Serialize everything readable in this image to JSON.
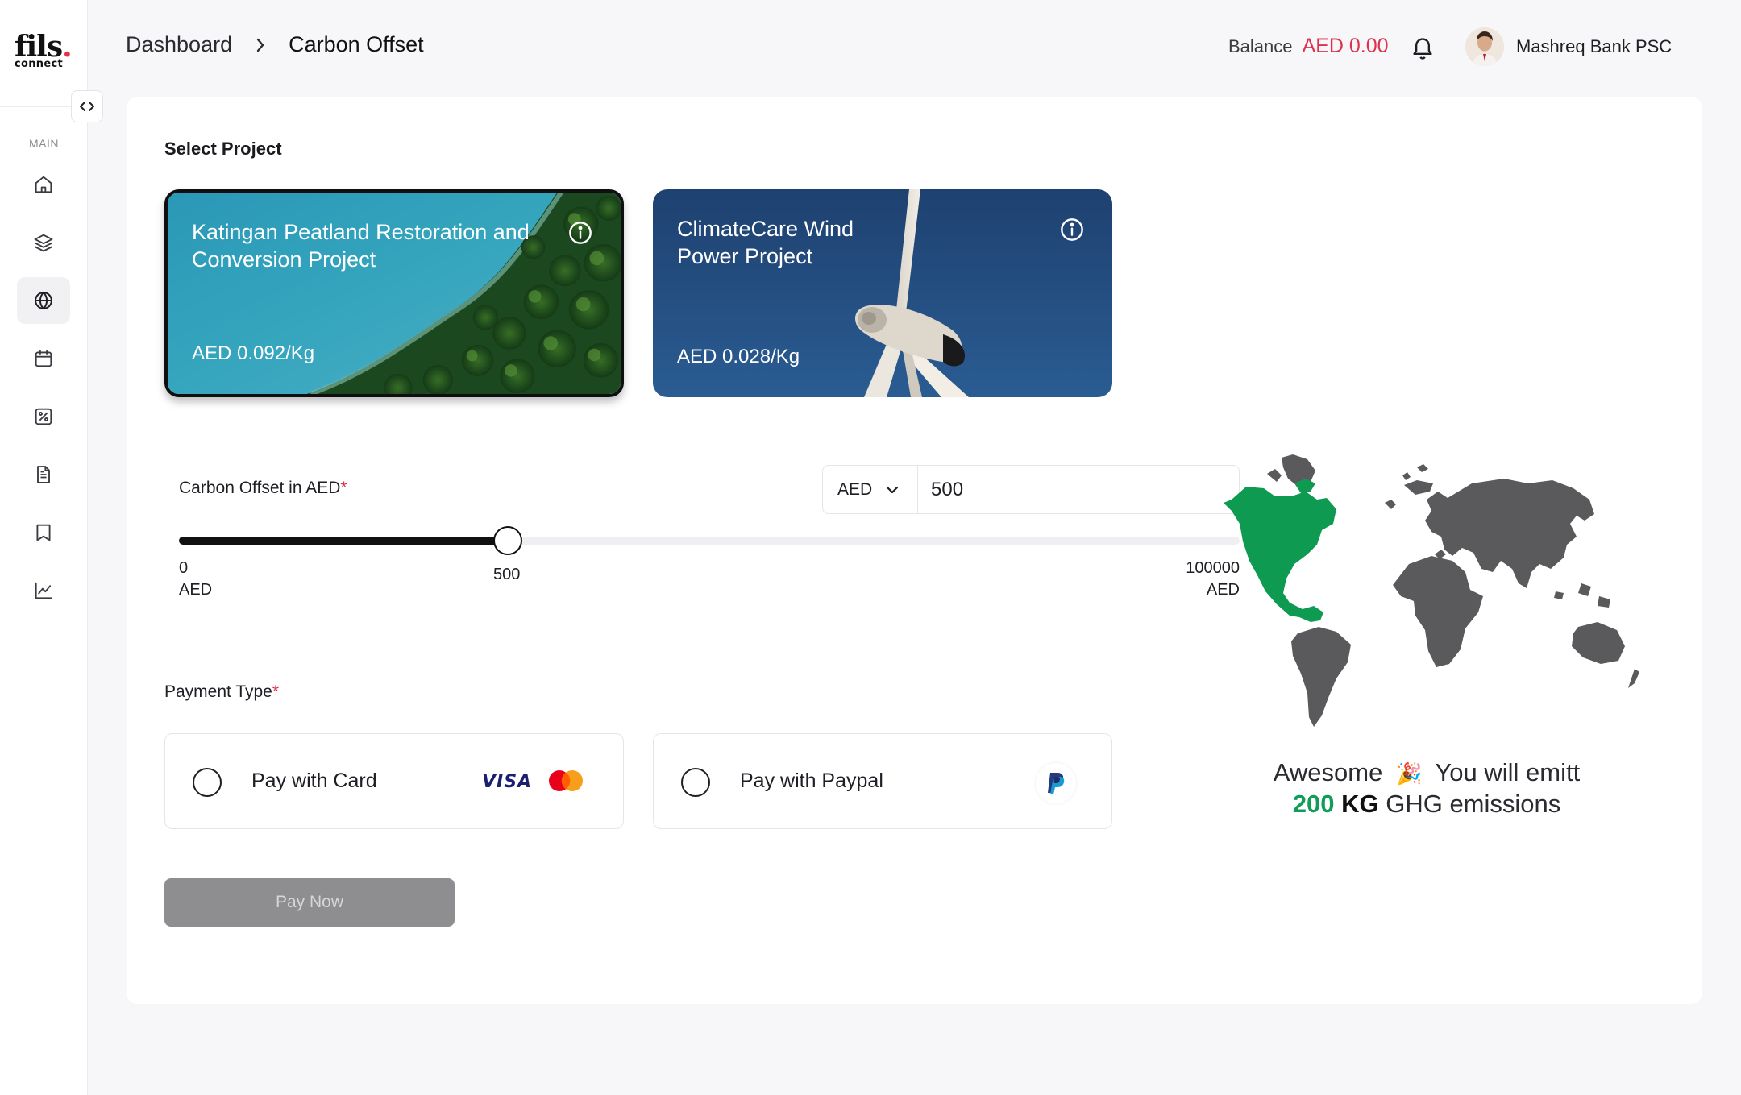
{
  "sidebar": {
    "logo_main": "fils",
    "logo_sub": "connect",
    "section_label": "MAIN",
    "items": [
      {
        "icon": "home-icon"
      },
      {
        "icon": "layers-icon"
      },
      {
        "icon": "globe-icon",
        "active": true
      },
      {
        "icon": "calendar-icon"
      },
      {
        "icon": "percent-icon"
      },
      {
        "icon": "document-icon"
      },
      {
        "icon": "bookmark-icon"
      },
      {
        "icon": "chart-icon"
      }
    ]
  },
  "header": {
    "breadcrumb": [
      "Dashboard",
      "Carbon Offset"
    ],
    "balance_label": "Balance",
    "balance_amount": "AED 0.00",
    "user_name": "Mashreq Bank PSC"
  },
  "main": {
    "section_title": "Select Project",
    "projects": [
      {
        "title": "Katingan Peatland Restoration and Conversion Project",
        "price": "AED 0.092/Kg",
        "selected": true
      },
      {
        "title": "ClimateCare Wind Power Project",
        "price": "AED 0.028/Kg",
        "selected": false
      }
    ],
    "offset_label": "Carbon Offset in AED",
    "required_mark": "*",
    "currency": "AED",
    "amount_value": "500",
    "slider": {
      "min": 0,
      "max": 100000,
      "value": 500,
      "min_label": "0",
      "min_unit": "AED",
      "value_label": "500",
      "max_label": "100000",
      "max_unit": "AED"
    },
    "payment_label": "Payment Type",
    "payment_options": [
      {
        "label": "Pay with Card",
        "brand_text": "VISA"
      },
      {
        "label": "Pay with Paypal"
      }
    ],
    "pay_button": "Pay Now",
    "emission": {
      "prefix": "Awesome",
      "emoji": "🎉",
      "middle": "You will emitt",
      "quantity": "200",
      "unit": "KG",
      "suffix": "GHG emissions"
    }
  },
  "colors": {
    "accent_red": "#e0304e",
    "accent_green": "#119d57",
    "map_gray": "#5a5a5c"
  }
}
